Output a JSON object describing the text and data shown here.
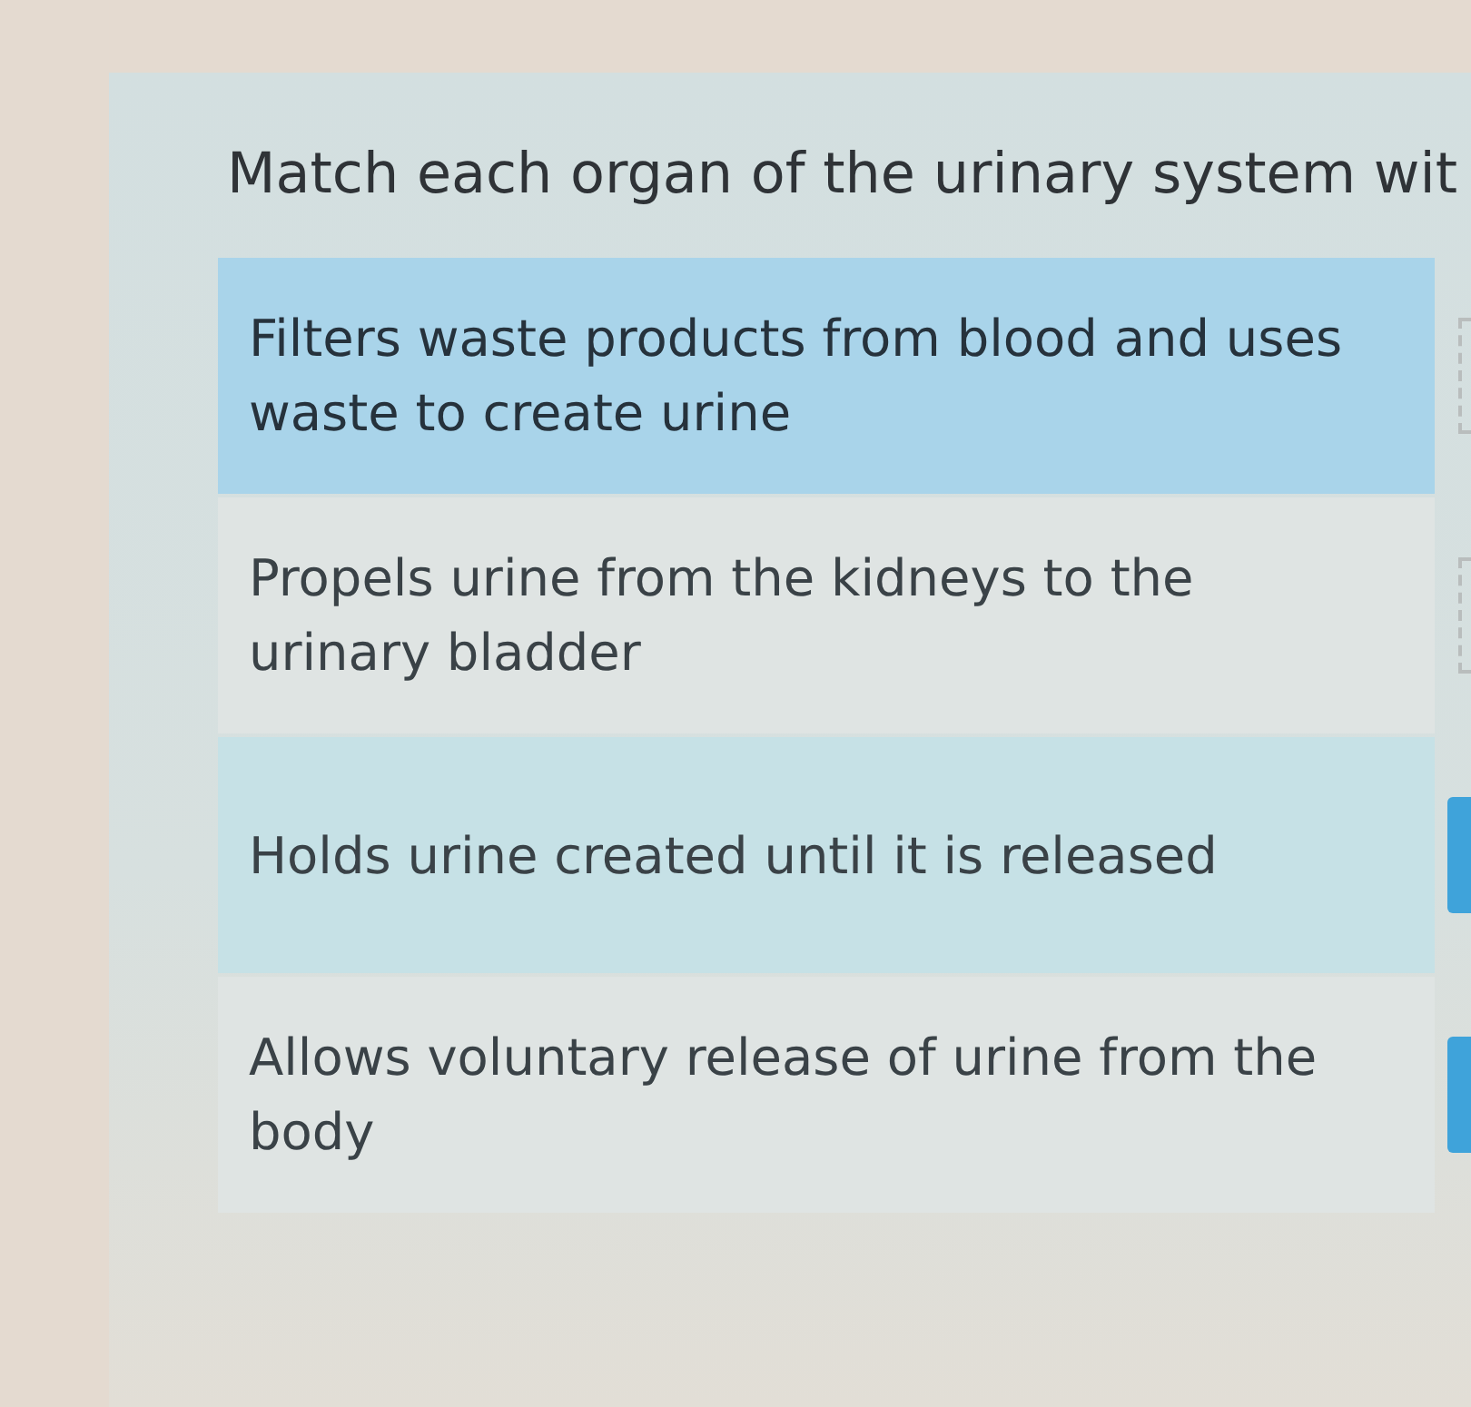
{
  "question": "Match each organ of the urinary system wit",
  "items": [
    {
      "text": "Filters waste products from blood and uses waste to create urine",
      "selected": true,
      "answer_filled": false
    },
    {
      "text": "Propels urine from the kidneys to the urinary bladder",
      "selected": false,
      "answer_filled": false
    },
    {
      "text": "Holds urine created until it is released",
      "selected": false,
      "answer_filled": true
    },
    {
      "text": "Allows voluntary release of urine from the body",
      "selected": false,
      "answer_filled": true
    }
  ]
}
